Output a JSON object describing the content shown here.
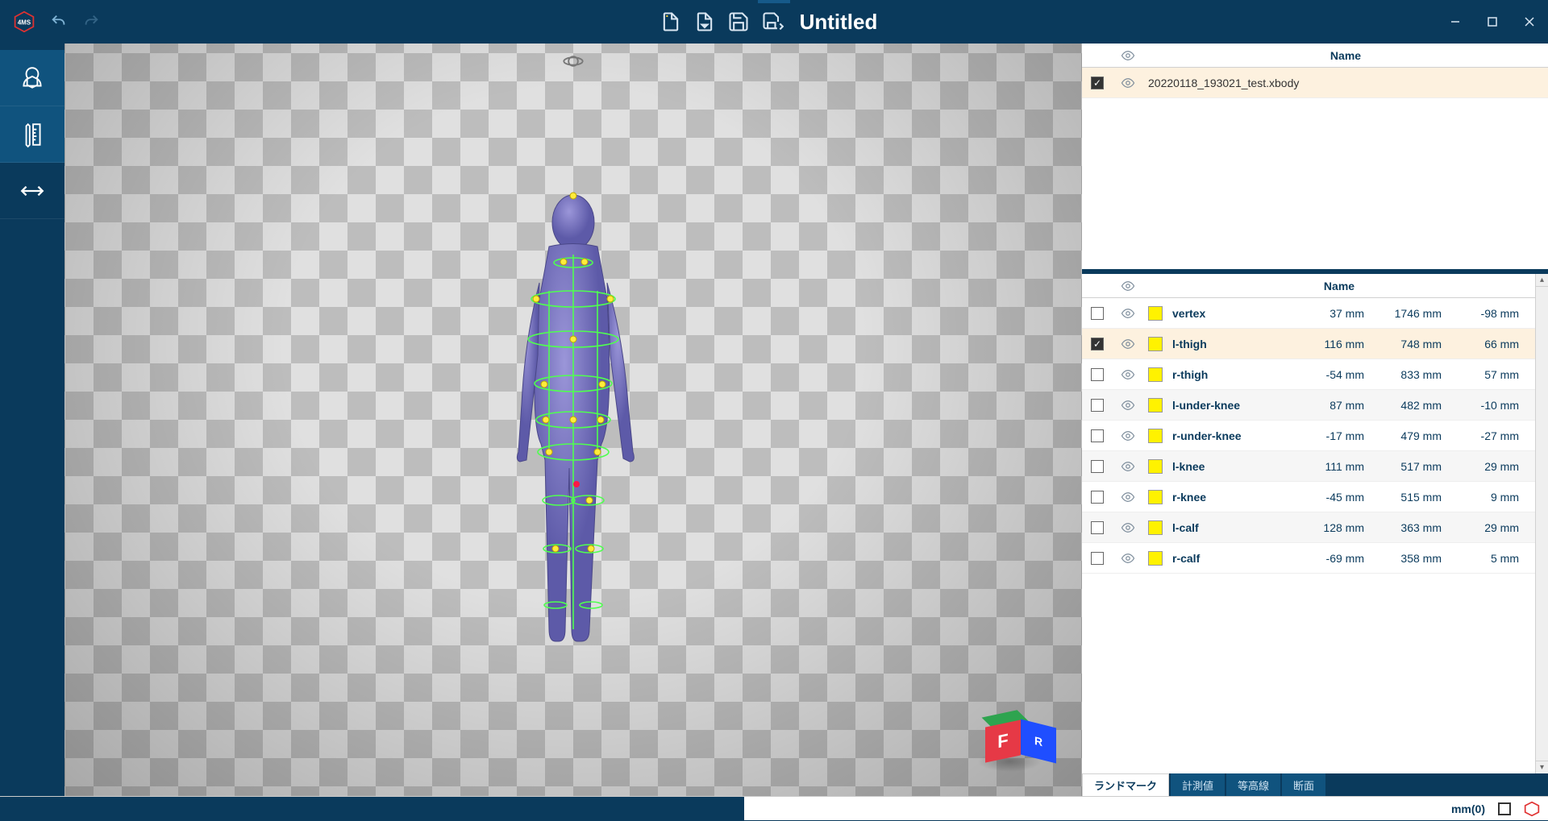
{
  "titlebar": {
    "title": "Untitled"
  },
  "panelTop": {
    "headerName": "Name",
    "rows": [
      {
        "checked": true,
        "name": "20220118_193021_test.xbody"
      }
    ]
  },
  "panelBottom": {
    "headerName": "Name",
    "rows": [
      {
        "checked": false,
        "name": "vertex",
        "x": "37 mm",
        "y": "1746 mm",
        "z": "-98 mm",
        "striped": false
      },
      {
        "checked": true,
        "name": "l-thigh",
        "x": "116 mm",
        "y": "748 mm",
        "z": "66 mm",
        "selected": true
      },
      {
        "checked": false,
        "name": "r-thigh",
        "x": "-54 mm",
        "y": "833 mm",
        "z": "57 mm",
        "striped": false
      },
      {
        "checked": false,
        "name": "l-under-knee",
        "x": "87 mm",
        "y": "482 mm",
        "z": "-10 mm",
        "striped": true
      },
      {
        "checked": false,
        "name": "r-under-knee",
        "x": "-17 mm",
        "y": "479 mm",
        "z": "-27 mm",
        "striped": false
      },
      {
        "checked": false,
        "name": "l-knee",
        "x": "111 mm",
        "y": "517 mm",
        "z": "29 mm",
        "striped": true
      },
      {
        "checked": false,
        "name": "r-knee",
        "x": "-45 mm",
        "y": "515 mm",
        "z": "9 mm",
        "striped": false
      },
      {
        "checked": false,
        "name": "l-calf",
        "x": "128 mm",
        "y": "363 mm",
        "z": "29 mm",
        "striped": true
      },
      {
        "checked": false,
        "name": "r-calf",
        "x": "-69 mm",
        "y": "358 mm",
        "z": "5 mm",
        "striped": false
      }
    ]
  },
  "tabs": {
    "items": [
      {
        "label": "ランドマーク",
        "active": true
      },
      {
        "label": "計測値",
        "active": false
      },
      {
        "label": "等高線",
        "active": false
      },
      {
        "label": "断面",
        "active": false
      }
    ]
  },
  "statusbar": {
    "unit": "mm(0)"
  },
  "orientation": {
    "front": "F",
    "right": "R"
  }
}
